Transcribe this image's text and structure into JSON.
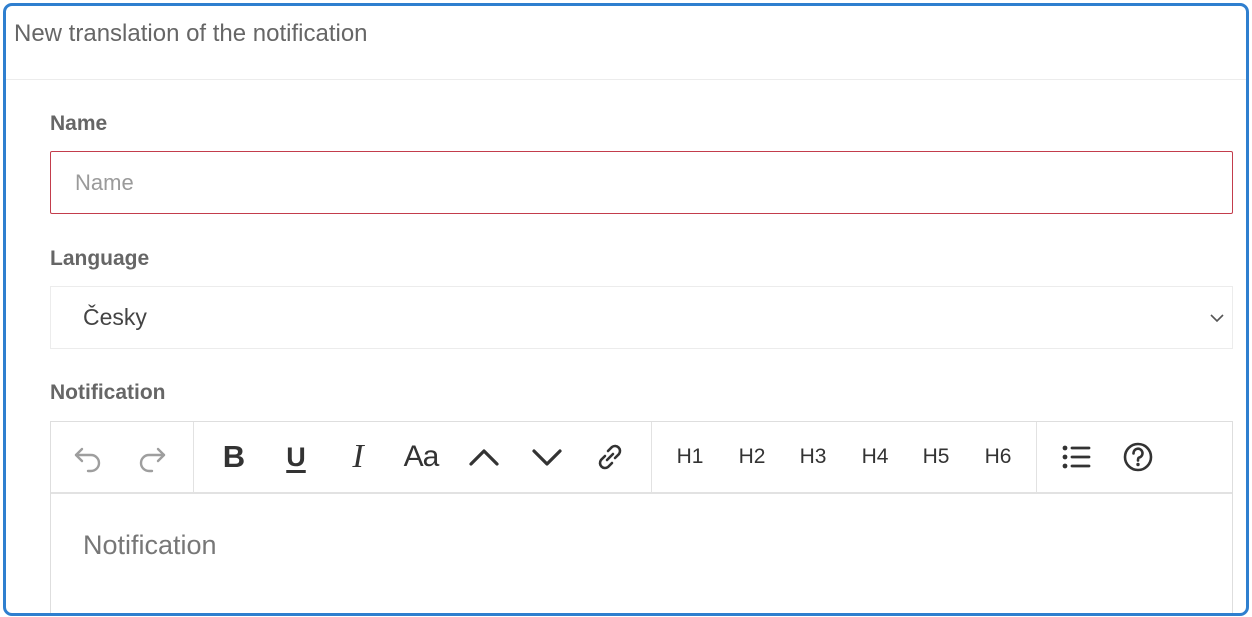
{
  "dialog": {
    "title": "New translation of the notification"
  },
  "form": {
    "name": {
      "label": "Name",
      "placeholder": "Name",
      "value": "",
      "state_color": "#c33d4c"
    },
    "language": {
      "label": "Language",
      "selected": "Česky"
    },
    "notification": {
      "label": "Notification",
      "placeholder": "Notification"
    }
  },
  "toolbar": {
    "groups": [
      {
        "items": [
          {
            "icon": "undo-icon",
            "enabled": false
          },
          {
            "icon": "redo-icon",
            "enabled": false
          }
        ]
      },
      {
        "items": [
          {
            "icon": "bold-icon",
            "label": "B"
          },
          {
            "icon": "underline-icon",
            "label": "U"
          },
          {
            "icon": "italic-icon",
            "label": "I"
          },
          {
            "icon": "font-size-icon",
            "label": "Aa"
          },
          {
            "icon": "chevron-up-icon"
          },
          {
            "icon": "chevron-down-icon"
          },
          {
            "icon": "link-icon"
          }
        ]
      },
      {
        "items": [
          {
            "label": "H1"
          },
          {
            "label": "H2"
          },
          {
            "label": "H3"
          },
          {
            "label": "H4"
          },
          {
            "label": "H5"
          },
          {
            "label": "H6"
          }
        ]
      },
      {
        "items": [
          {
            "icon": "bullet-list-icon"
          },
          {
            "icon": "help-icon"
          }
        ]
      }
    ]
  },
  "colors": {
    "accent_border": "#2f7fcf",
    "label_text": "#666666",
    "error_border": "#c33d4c"
  }
}
